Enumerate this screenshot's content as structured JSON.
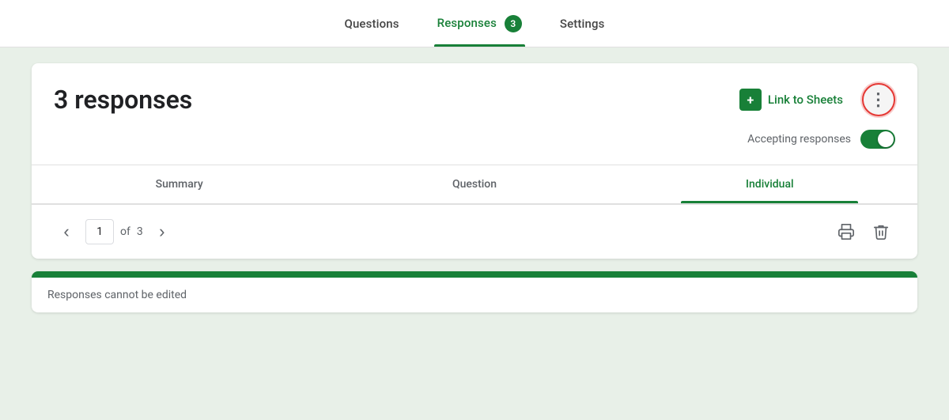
{
  "tabs": {
    "questions": {
      "label": "Questions",
      "active": false
    },
    "responses": {
      "label": "Responses",
      "active": true,
      "badge": "3"
    },
    "settings": {
      "label": "Settings",
      "active": false
    }
  },
  "header": {
    "response_count_label": "3 responses",
    "link_to_sheets_label": "Link to Sheets",
    "more_icon": "⋮",
    "sheets_icon_label": "+"
  },
  "accepting": {
    "label": "Accepting responses",
    "enabled": true
  },
  "sub_tabs": {
    "summary": {
      "label": "Summary",
      "active": false
    },
    "question": {
      "label": "Question",
      "active": false
    },
    "individual": {
      "label": "Individual",
      "active": true
    }
  },
  "pagination": {
    "current": "1",
    "of_label": "of",
    "total": "3",
    "prev_icon": "‹",
    "next_icon": "›"
  },
  "notice": {
    "text": "Responses cannot be edited"
  },
  "colors": {
    "green": "#188038",
    "red_border": "#e53935"
  }
}
